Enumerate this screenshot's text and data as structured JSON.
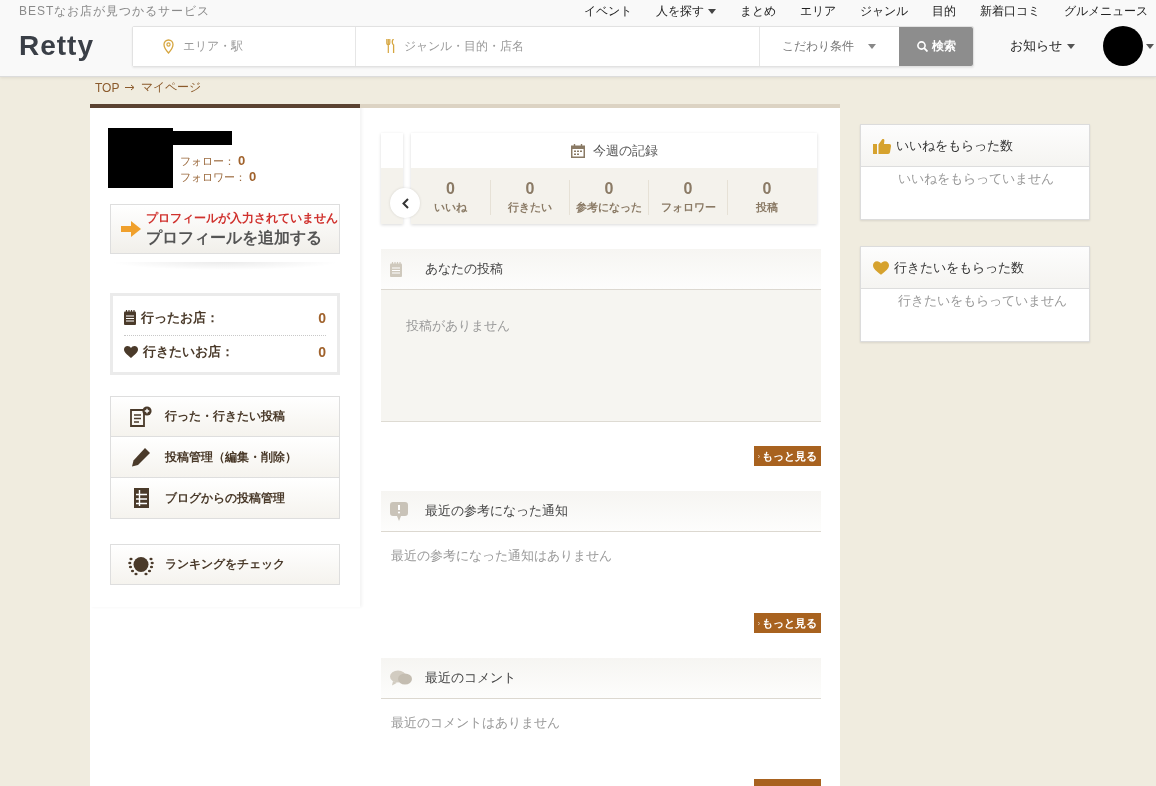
{
  "header": {
    "tagline": "BESTなお店が見つかるサービス",
    "nav": [
      {
        "label": "イベント",
        "dropdown": false
      },
      {
        "label": "人を探す",
        "dropdown": true
      },
      {
        "label": "まとめ",
        "dropdown": false
      },
      {
        "label": "エリア",
        "dropdown": false
      },
      {
        "label": "ジャンル",
        "dropdown": false
      },
      {
        "label": "目的",
        "dropdown": false
      },
      {
        "label": "新着口コミ",
        "dropdown": false
      },
      {
        "label": "グルメニュース",
        "dropdown": false
      }
    ],
    "logo": "Retty",
    "search": {
      "area_placeholder": "エリア・駅",
      "genre_placeholder": "ジャンル・目的・店名",
      "filter": "こだわり条件",
      "button": "検索"
    },
    "notice": "お知らせ"
  },
  "breadcrumb": [
    "TOP",
    "マイページ"
  ],
  "profile": {
    "follow": [
      {
        "label": "フォロー：",
        "count": "0"
      },
      {
        "label": "フォロワー：",
        "count": "0"
      }
    ],
    "add_profile": {
      "warning": "プロフィールが入力されていません",
      "label": "プロフィールを追加する"
    }
  },
  "shop_counts": [
    {
      "kind": "visited",
      "label": "行ったお店：",
      "count": "0"
    },
    {
      "kind": "wish",
      "label": "行きたいお店：",
      "count": "0"
    }
  ],
  "menu": [
    {
      "kind": "post",
      "label": "行った・行きたい投稿"
    },
    {
      "kind": "manage",
      "label": "投稿管理（編集・削除）"
    },
    {
      "kind": "blog",
      "label": "ブログからの投稿管理"
    }
  ],
  "ranking": {
    "label": "ランキングをチェック"
  },
  "weekly": {
    "title": "今週の記録",
    "stats": [
      {
        "value": "0",
        "label": "いいね"
      },
      {
        "value": "0",
        "label": "行きたい"
      },
      {
        "value": "0",
        "label": "参考になった"
      },
      {
        "value": "0",
        "label": "フォロワー"
      },
      {
        "value": "0",
        "label": "投稿"
      }
    ]
  },
  "sections": [
    {
      "kind": "posts",
      "title": "あなたの投稿",
      "empty": "投稿がありません",
      "more": {
        "label": "もっと見る"
      }
    },
    {
      "kind": "notices",
      "title": "最近の参考になった通知",
      "empty": "最近の参考になった通知はありません",
      "more": {
        "label": "もっと見る"
      }
    },
    {
      "kind": "comments",
      "title": "最近のコメント",
      "empty": "最近のコメントはありません",
      "more": {
        "cut_off": true
      }
    }
  ],
  "received": [
    {
      "kind": "like",
      "title": "いいねをもらった数",
      "empty": "いいねをもらっていません"
    },
    {
      "kind": "wish",
      "title": "行きたいをもらった数",
      "empty": "行きたいをもらっていません"
    }
  ]
}
